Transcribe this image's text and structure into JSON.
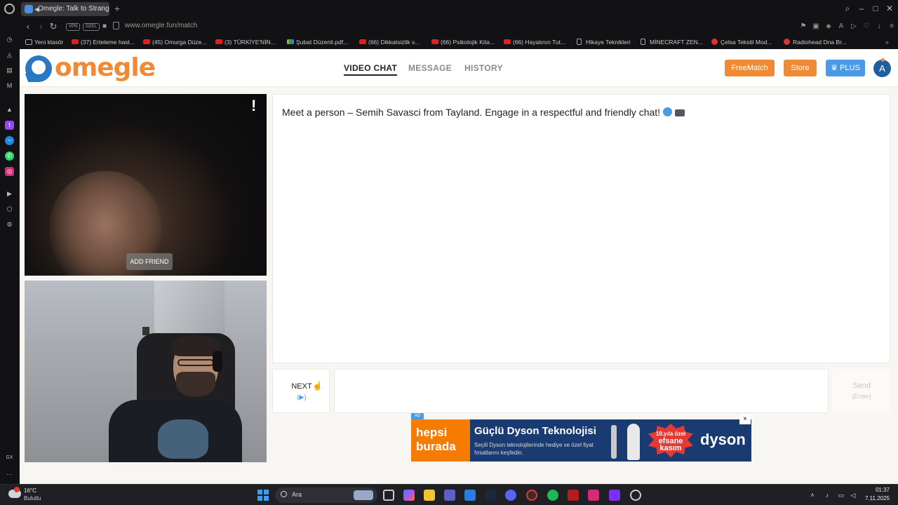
{
  "browser": {
    "tab_title": "Omegle: Talk to Strangers",
    "url": "www.omegle.fun/match",
    "vpn_label": "VPN",
    "private_label": "ÖZEL",
    "bookmarks": [
      {
        "label": "Yeni klasör",
        "icon": "folder-icon"
      },
      {
        "label": "(37) Erteleme hast...",
        "icon": "youtube-icon"
      },
      {
        "label": "(45) Omurga Düze...",
        "icon": "youtube-icon"
      },
      {
        "label": "(3) TÜRKİYE'NİN...",
        "icon": "youtube-icon"
      },
      {
        "label": "Şubat Düzenli.pdf...",
        "icon": "drive-icon"
      },
      {
        "label": "(66) Dikkatsizlik v...",
        "icon": "youtube-icon"
      },
      {
        "label": "(66) Psikolojik Kita...",
        "icon": "youtube-icon"
      },
      {
        "label": "(66) Hayatının Tut...",
        "icon": "youtube-icon"
      },
      {
        "label": "Hikaye Teknikleri",
        "icon": "document-icon"
      },
      {
        "label": "MİNECRAFT ZEN...",
        "icon": "document-icon"
      },
      {
        "label": "Çelsa Tekstil Mod...",
        "icon": "site-icon"
      },
      {
        "label": "Radiohead Dna Br...",
        "icon": "site-icon"
      }
    ]
  },
  "site": {
    "logo_text": "omegle",
    "nav": {
      "video_chat": "VIDEO CHAT",
      "message": "MESSAGE",
      "history": "HISTORY"
    },
    "buttons": {
      "freematch": "FreeMatch",
      "store": "Store",
      "plus": "PLUS"
    },
    "avatar_initial": "A",
    "colors": {
      "brand_orange": "#f08a35",
      "brand_blue": "#2b78c2",
      "plus_blue": "#4a9ae8"
    }
  },
  "video": {
    "report_glyph": "!",
    "add_friend_label": "ADD FRIEND"
  },
  "chat": {
    "intro": "Meet a person – Semih Savasci from Tayland. Engage in a respectful and friendly chat!",
    "next_label": "NEXT",
    "next_sub": "(▶)",
    "send_label": "Send",
    "send_sub": "(Enter)"
  },
  "ad": {
    "tag": "AD",
    "brand_logo_line1": "hepsi",
    "brand_logo_line2": "burada",
    "title": "Güçlü Dyson Teknolojisi",
    "body": "Seçili Dyson teknolojilerinde hediye ve özel fiyat fırsatlarını keşfedin.",
    "badge_line1": "10.yıla özel",
    "badge_line2": "efsane",
    "badge_line3": "kasım",
    "product_brand": "dyson",
    "close_glyph": "×"
  },
  "taskbar": {
    "weather_temp": "16°C",
    "weather_desc": "Bulutlu",
    "search_placeholder": "Ara",
    "time": "01:37",
    "date": "7.11.2025"
  }
}
